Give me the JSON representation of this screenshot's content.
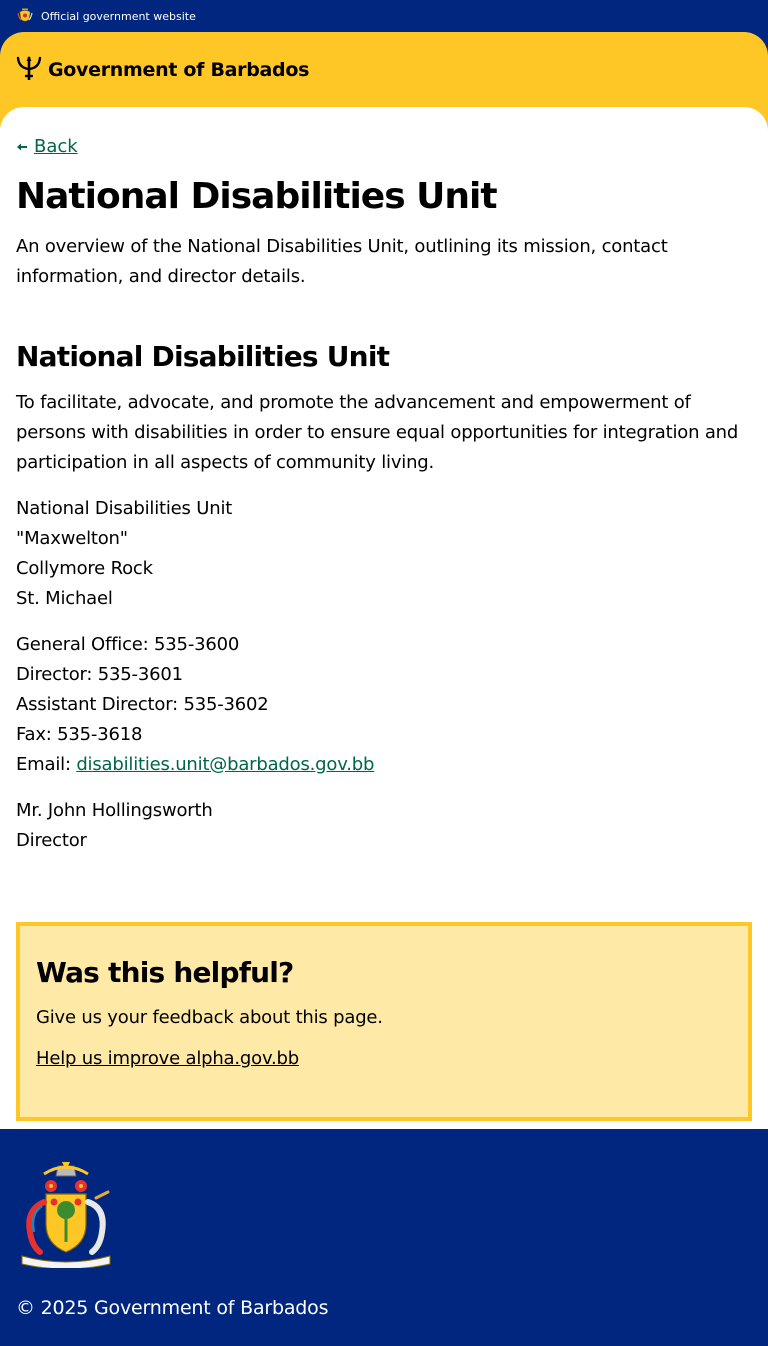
{
  "official_bar": {
    "text": "Official government website"
  },
  "header": {
    "brand_name": "Government of Barbados"
  },
  "nav": {
    "back_label": "Back"
  },
  "page": {
    "title": "National Disabilities Unit",
    "lede": "An overview of the National Disabilities Unit, outlining its mission, contact information, and director details.",
    "section_title": "National Disabilities Unit",
    "mission": "To facilitate, advocate, and promote the advancement and empowerment of persons with disabilities in order to ensure equal opportunities for integration and participation in all aspects of community living.",
    "address": [
      "National Disabilities Unit",
      "\"Maxwelton\"",
      "Collymore Rock",
      "St. Michael"
    ],
    "contacts": [
      "General Office: 535-3600",
      "Director: 535-3601",
      "Assistant Director: 535-3602",
      "Fax: 535-3618"
    ],
    "email_label": "Email: ",
    "email": "disabilities.unit@barbados.gov.bb",
    "director": [
      "Mr. John Hollingsworth",
      "Director"
    ]
  },
  "feedback": {
    "title": "Was this helpful?",
    "text": "Give us your feedback about this page.",
    "link": "Help us improve alpha.gov.bb"
  },
  "footer": {
    "copyright": "© 2025 Government of Barbados"
  },
  "colors": {
    "navy": "#00267F",
    "gold": "#FFC726",
    "feedback_bg": "#FFE9A6",
    "link_green": "#00654A"
  },
  "icons": {
    "official_bar": "coat-of-arms-icon",
    "brand": "trident-icon",
    "back": "arrow-left-icon",
    "footer": "coat-of-arms-icon"
  }
}
